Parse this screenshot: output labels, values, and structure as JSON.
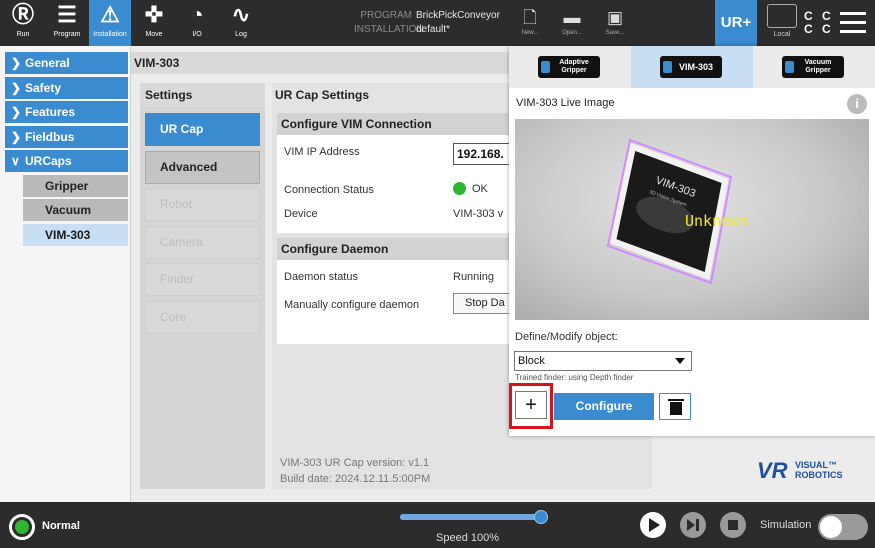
{
  "topbar": {
    "nav": [
      {
        "label": "Run",
        "icon": "ur-logo-icon"
      },
      {
        "label": "Program",
        "icon": "program-icon"
      },
      {
        "label": "Installation",
        "icon": "installation-icon"
      },
      {
        "label": "Move",
        "icon": "move-icon"
      },
      {
        "label": "I/O",
        "icon": "io-icon"
      },
      {
        "label": "Log",
        "icon": "log-icon"
      }
    ],
    "program_key": "PROGRAM",
    "program_value": "BrickPickConveyor",
    "installation_key": "INSTALLATION",
    "installation_value": "default*",
    "file": [
      {
        "label": "New...",
        "icon": "new-file-icon"
      },
      {
        "label": "Open...",
        "icon": "open-folder-icon"
      },
      {
        "label": "Save...",
        "icon": "save-icon"
      }
    ],
    "urplus_label": "UR+",
    "local_label": "Local"
  },
  "sidebar": {
    "items": [
      {
        "label": "General",
        "expanded": false
      },
      {
        "label": "Safety",
        "expanded": false
      },
      {
        "label": "Features",
        "expanded": false
      },
      {
        "label": "Fieldbus",
        "expanded": false
      },
      {
        "label": "URCaps",
        "expanded": true
      }
    ],
    "subitems": [
      {
        "label": "Gripper",
        "active": false
      },
      {
        "label": "Vacuum",
        "active": false
      },
      {
        "label": "VIM-303",
        "active": true
      }
    ]
  },
  "main": {
    "title": "VIM-303",
    "settings_header": "Settings",
    "settings_buttons": [
      {
        "label": "UR Cap",
        "state": "active"
      },
      {
        "label": "Advanced",
        "state": "normal"
      },
      {
        "label": "Robot",
        "state": "disabled"
      },
      {
        "label": "Camera",
        "state": "disabled"
      },
      {
        "label": "Finder",
        "state": "disabled"
      },
      {
        "label": "Core",
        "state": "disabled"
      }
    ],
    "cap_header": "UR Cap Settings",
    "vim_connection": {
      "title": "Configure VIM Connection",
      "ip_label": "VIM IP Address",
      "ip_value": "192.168.",
      "status_label": "Connection Status",
      "status_value": "OK",
      "device_label": "Device",
      "device_value": "VIM-303 v"
    },
    "daemon": {
      "title": "Configure Daemon",
      "status_label": "Daemon status",
      "status_value": "Running",
      "manual_label": "Manually configure daemon",
      "stop_button": "Stop Da"
    },
    "version_line": "VIM-303 UR Cap version:  v1.1",
    "build_line": "Build date:  2024.12.11.5:00PM",
    "logo_vr": "VR",
    "logo_t1": "VISUAL™",
    "logo_t2": "ROBOTICS"
  },
  "panel": {
    "tabs": [
      {
        "label": "Adaptive Gripper",
        "active": false
      },
      {
        "label": "VIM-303",
        "active": true
      },
      {
        "label": "Vacuum Gripper",
        "active": false
      }
    ],
    "live_title": "VIM-303 Live Image",
    "info_icon": "i",
    "detection_label": "Unknown",
    "box_title": "VIM-303",
    "box_subtitle": "3D Vision System",
    "define_label": "Define/Modify object:",
    "selected_object": "Block",
    "finder_note": "Trained finder: using Depth finder",
    "add_symbol": "+",
    "configure_label": "Configure"
  },
  "bottombar": {
    "status": "Normal",
    "speed_text": "Speed 100%",
    "speed_value": 100,
    "simulation_label": "Simulation",
    "simulation_on": false
  },
  "colors": {
    "accent": "#3b8bd0",
    "topbar": "#2c2c2c",
    "ok_green": "#2fb52f",
    "highlight_red": "#d8141b",
    "detection_outline": "#d28cff",
    "detection_text": "#f2e72b"
  }
}
